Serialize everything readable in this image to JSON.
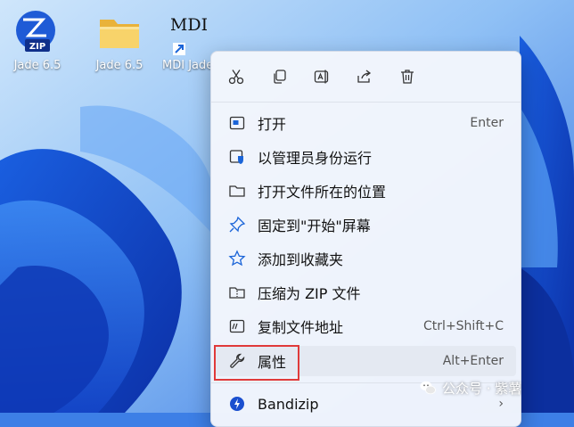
{
  "desktop": {
    "icons": [
      {
        "label": "Jade 6.5",
        "icon": "zip-app-icon",
        "badge": "ZIP"
      },
      {
        "label": "Jade 6.5",
        "icon": "folder-icon"
      },
      {
        "label": "MDI Jade",
        "icon": "shortcut-app-icon",
        "glyph": "MDI"
      }
    ]
  },
  "context_menu": {
    "quick_actions": [
      {
        "name": "cut",
        "icon": "scissors-icon"
      },
      {
        "name": "copy",
        "icon": "copy-icon"
      },
      {
        "name": "rename",
        "icon": "rename-icon"
      },
      {
        "name": "share",
        "icon": "share-icon"
      },
      {
        "name": "delete",
        "icon": "trash-icon"
      }
    ],
    "items": [
      {
        "label": "打开",
        "shortcut": "Enter",
        "icon": "open-window-icon"
      },
      {
        "label": "以管理员身份运行",
        "shortcut": "",
        "icon": "shield-icon"
      },
      {
        "label": "打开文件所在的位置",
        "shortcut": "",
        "icon": "folder-outline-icon"
      },
      {
        "label": "固定到\"开始\"屏幕",
        "shortcut": "",
        "icon": "pin-icon"
      },
      {
        "label": "添加到收藏夹",
        "shortcut": "",
        "icon": "star-icon"
      },
      {
        "label": "压缩为 ZIP 文件",
        "shortcut": "",
        "icon": "zip-folder-icon"
      },
      {
        "label": "复制文件地址",
        "shortcut": "Ctrl+Shift+C",
        "icon": "path-icon"
      },
      {
        "label": "属性",
        "shortcut": "Alt+Enter",
        "icon": "wrench-icon"
      },
      {
        "label": "Bandizip",
        "shortcut": "",
        "icon": "bandizip-icon",
        "submenu": true
      }
    ]
  },
  "watermark": {
    "text": "公众号 · 紫薯"
  },
  "colors": {
    "highlight_border": "#e03a3a",
    "accent": "#0067c0"
  }
}
